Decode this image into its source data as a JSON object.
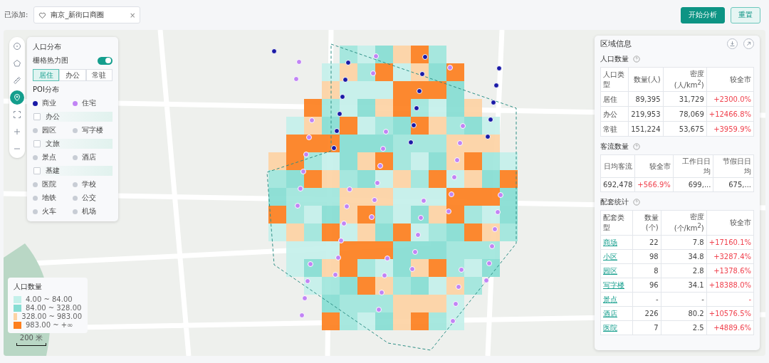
{
  "top_bar": {
    "label": "已添加:",
    "tag": {
      "text": "南京_新街口商圈",
      "close": "×"
    },
    "buttons": [
      {
        "label": "开始分析",
        "kind": "primary"
      },
      {
        "label": "重置",
        "kind": "secondary"
      }
    ]
  },
  "map_tools": [
    {
      "kind": "circle",
      "selected": false
    },
    {
      "kind": "pentagon",
      "selected": false
    },
    {
      "kind": "ruler",
      "selected": false
    },
    {
      "kind": "pin",
      "selected": true
    },
    {
      "kind": "fullscreen",
      "selected": false
    },
    {
      "kind": "zoom-in",
      "selected": false
    },
    {
      "kind": "zoom-out",
      "selected": false
    }
  ],
  "layer_panel": {
    "title": "人口分布",
    "heatmap": {
      "label": "栅格热力图",
      "on": true
    },
    "tabs": [
      {
        "label": "居住",
        "selected": true
      },
      {
        "label": "办公",
        "selected": false
      },
      {
        "label": "常驻",
        "selected": false
      }
    ],
    "poi_title": "POI分布",
    "poi_groups": [
      {
        "items": [
          {
            "label": "商业",
            "on": true,
            "color": "#1a1aa6"
          },
          {
            "label": "住宅",
            "on": true,
            "color": "#c184f5"
          }
        ]
      },
      {
        "label": "办公",
        "checked": false,
        "items": [
          {
            "label": "园区",
            "on": false
          },
          {
            "label": "写字楼",
            "on": false
          }
        ]
      },
      {
        "label": "文旅",
        "checked": false,
        "items": [
          {
            "label": "景点",
            "on": false
          },
          {
            "label": "酒店",
            "on": false
          }
        ]
      },
      {
        "label": "基建",
        "checked": false,
        "items": [
          {
            "label": "医院",
            "on": false
          },
          {
            "label": "学校",
            "on": false
          },
          {
            "label": "地铁",
            "on": false
          },
          {
            "label": "公交",
            "on": false
          },
          {
            "label": "火车",
            "on": false
          },
          {
            "label": "机场",
            "on": false
          }
        ]
      }
    ]
  },
  "legend": {
    "title": "人口数量",
    "items": [
      {
        "label": "4.00 ~ 84.00",
        "color": "#c4f0ea"
      },
      {
        "label": "84.00 ~ 328.00",
        "color": "#86ddd3"
      },
      {
        "label": "328.00 ~ 983.00",
        "color": "#fdd3a4"
      },
      {
        "label": "983.00 ~ +∞",
        "color": "#fd7f1e"
      }
    ]
  },
  "scale": "200 米",
  "info_panel": {
    "title": "区域信息",
    "sections": [
      {
        "title": "人口数量",
        "columns": [
          {
            "label": "人口类型",
            "kind": "text"
          },
          {
            "label": "数量(人)",
            "kind": "number"
          },
          {
            "label": "密度(人/km$^{2}$)",
            "kind": "number"
          },
          {
            "label": "较全市",
            "kind": "delta"
          }
        ],
        "rows": [
          [
            "居住",
            "89,395",
            "31,729",
            "+2300.0%"
          ],
          [
            "办公",
            "219,953",
            "78,069",
            "+12466.8%"
          ],
          [
            "常驻",
            "151,224",
            "53,675",
            "+3959.9%"
          ]
        ]
      },
      {
        "title": "客流数量",
        "columns": [
          {
            "label": "日均客流",
            "kind": "center"
          },
          {
            "label": "较全市",
            "kind": "delta"
          },
          {
            "label": "工作日日均",
            "kind": "number"
          },
          {
            "label": "节假日日均",
            "kind": "number"
          }
        ],
        "rows": [
          [
            "692,478",
            "+566.9%",
            "699,...",
            "675,..."
          ]
        ]
      },
      {
        "title": "配套统计",
        "columns": [
          {
            "label": "配套类型",
            "kind": "link"
          },
          {
            "label": "数量(个)",
            "kind": "number"
          },
          {
            "label": "密度(个/km$^{2}$)",
            "kind": "number"
          },
          {
            "label": "较全市",
            "kind": "delta"
          }
        ],
        "rows": [
          [
            "商场",
            "22",
            "7.8",
            "+17160.1%"
          ],
          [
            "小区",
            "98",
            "34.8",
            "+3287.4%"
          ],
          [
            "园区",
            "8",
            "2.8",
            "+1378.6%"
          ],
          [
            "写字楼",
            "96",
            "34.1",
            "+18388.0%"
          ],
          [
            "景点",
            "-",
            "-",
            "-"
          ],
          [
            "酒店",
            "226",
            "80.2",
            "+10576.5%"
          ],
          [
            "医院",
            "7",
            "2.5",
            "+4889.6%"
          ]
        ]
      }
    ]
  }
}
